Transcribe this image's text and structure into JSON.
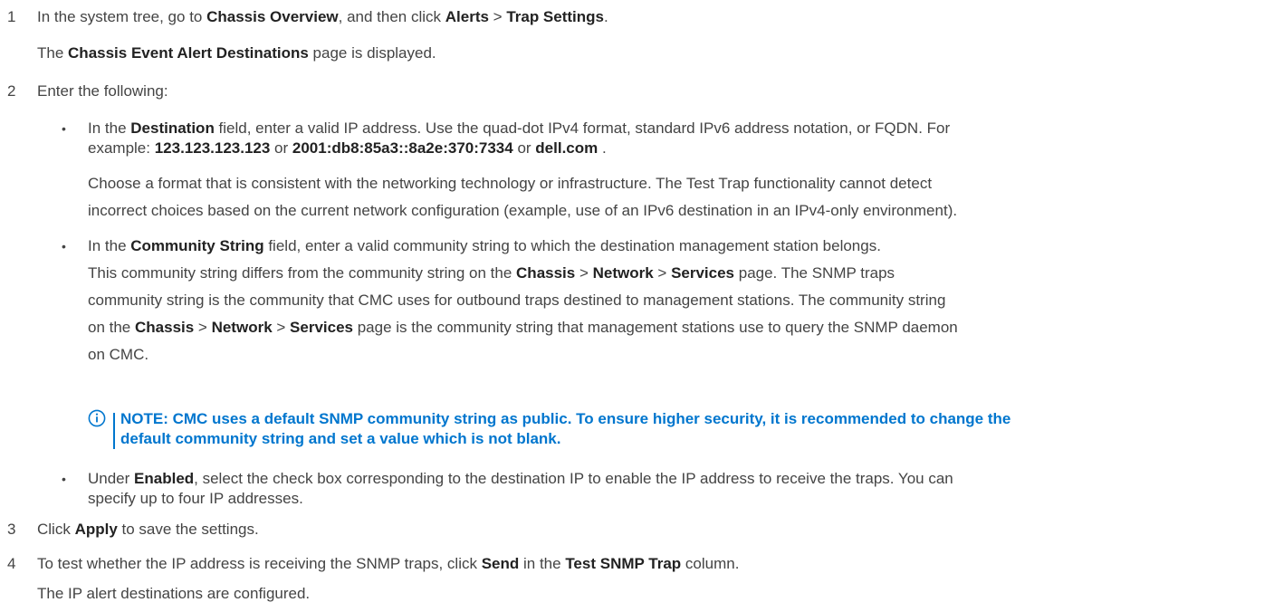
{
  "steps": [
    {
      "num": "1",
      "lines": [
        [
          "In the system tree, go to ",
          "Chassis Overview",
          ", and then click ",
          "Alerts",
          " > ",
          "Trap Settings",
          "."
        ],
        [
          "The ",
          "Chassis Event Alert Destinations",
          " page is displayed."
        ]
      ]
    },
    {
      "num": "2",
      "text": "Enter the following:"
    },
    {
      "num": "3",
      "a": "Click ",
      "b": "Apply",
      "c": " to save the settings."
    },
    {
      "num": "4",
      "a": "To test whether the IP address is receiving the SNMP traps, click ",
      "b": "Send",
      "c": " in the ",
      "d": "Test SNMP Trap",
      "e": " column.",
      "result": "The IP alert destinations are configured."
    }
  ],
  "bullets": {
    "destination": {
      "l1a": "In the ",
      "l1b": "Destination",
      "l1c": " field, enter a valid IP address. Use the quad-dot IPv4 format, standard IPv6 address notation, or FQDN. For",
      "l2a": "example: ",
      "ex1": "123.123.123.123",
      "or1": " or ",
      "ex2": "2001:db8:85a3::8a2e:370:7334",
      "or2": " or ",
      "ex3": "dell.com",
      "l2end": " .",
      "p2l1": "Choose a format that is consistent with the networking technology or infrastructure. The Test Trap functionality cannot detect",
      "p2l2": "incorrect choices based on the current network configuration (example, use of an IPv6 destination in an IPv4-only environment)."
    },
    "community": {
      "l1a": "In the ",
      "l1b": "Community String",
      "l1c": " field, enter a valid community string to which the destination management station belongs.",
      "p2l1a": "This community string differs from the community string on the ",
      "chassis": "Chassis",
      "gt": " > ",
      "network": "Network",
      "services": "Services",
      "p2l1e": " page. The SNMP traps",
      "p2l2": "community string is the community that CMC uses for outbound traps destined to management stations. The community string",
      "p2l3a": "on the ",
      "p2l3e": " page is the community string that management stations use to query the SNMP daemon",
      "p2l4": "on CMC."
    },
    "enabled": {
      "l1a": "Under ",
      "l1b": "Enabled",
      "l1c": ", select the check box corresponding to the destination IP to enable the IP address to receive the traps. You can",
      "l2": "specify up to four IP addresses."
    }
  },
  "note": {
    "line1": "NOTE: CMC uses a default SNMP community string as public. To ensure higher security, it is recommended to change the",
    "line2": "default community string and set a value which is not blank.",
    "color": "#0076ce",
    "icon": "info-icon"
  }
}
